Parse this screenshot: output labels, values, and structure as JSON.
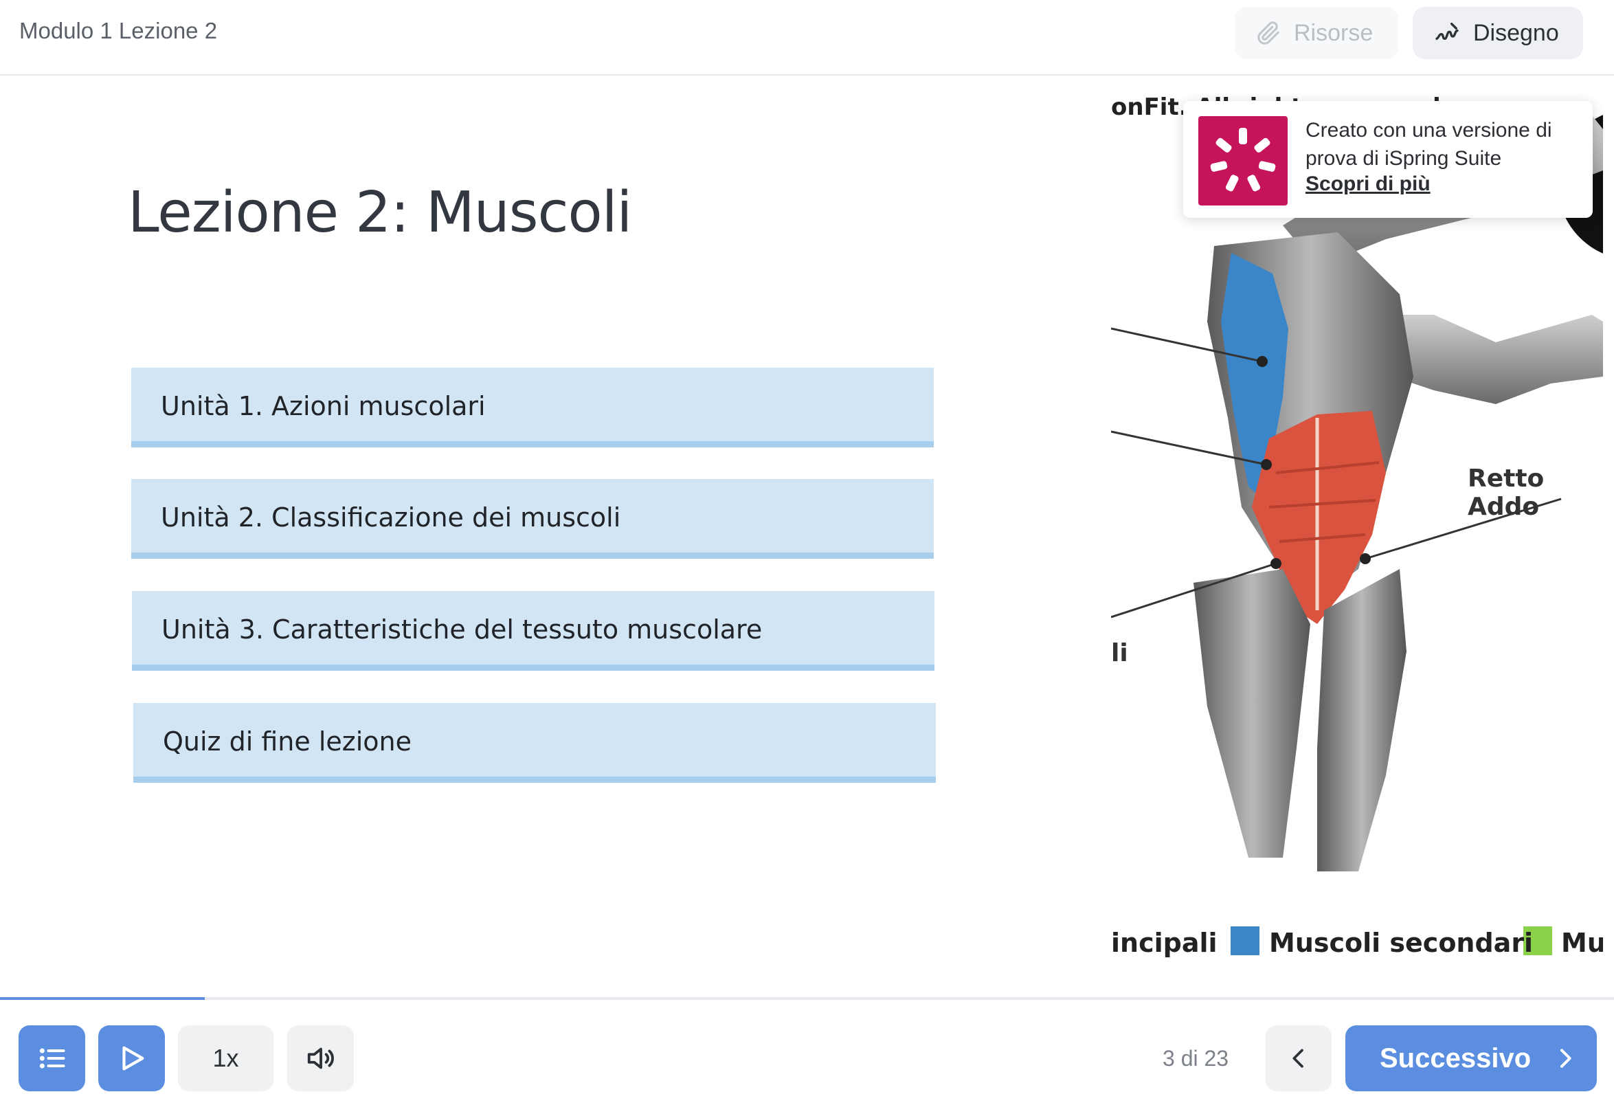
{
  "header": {
    "breadcrumb": "Modulo 1 Lezione 2",
    "resources_label": "Risorse",
    "resources_icon": "paperclip-icon",
    "drawing_label": "Disegno",
    "drawing_icon": "squiggle-pen-icon"
  },
  "slide": {
    "title": "Lezione 2: Muscoli",
    "units": [
      {
        "label": "Unità 1. Azioni muscolari"
      },
      {
        "label": "Unità 2. Classificazione dei muscoli"
      },
      {
        "label": "Unità 3. Caratteristiche del tessuto muscolare"
      },
      {
        "label": "Quiz di fine lezione"
      }
    ],
    "illustration": {
      "copyright": "onFit. All rights reserved.",
      "label_retto": "Retto Addo",
      "label_fragment": "li",
      "legend": [
        "incipali",
        "Muscoli secondari",
        "Mu"
      ],
      "colors": {
        "primary_muscle": "#d9533f",
        "secondary_muscle": "#3a86c8",
        "tertiary_muscle": "#8bd14a"
      }
    }
  },
  "trial_banner": {
    "text": "Creato con una versione di prova di iSpring Suite",
    "link": "Scopri di più"
  },
  "player": {
    "progress_percent": 12.7,
    "speed_label": "1x",
    "page_counter": "3 di 23",
    "next_label": "Successivo",
    "icons": [
      "menu-list-icon",
      "play-icon",
      "volume-icon",
      "chevron-left-icon",
      "chevron-right-icon"
    ]
  },
  "colors": {
    "accent": "#5b8ee0",
    "unit_bg": "#d2e5f4",
    "unit_border": "#a6cdec",
    "brand": "#c5145a"
  }
}
